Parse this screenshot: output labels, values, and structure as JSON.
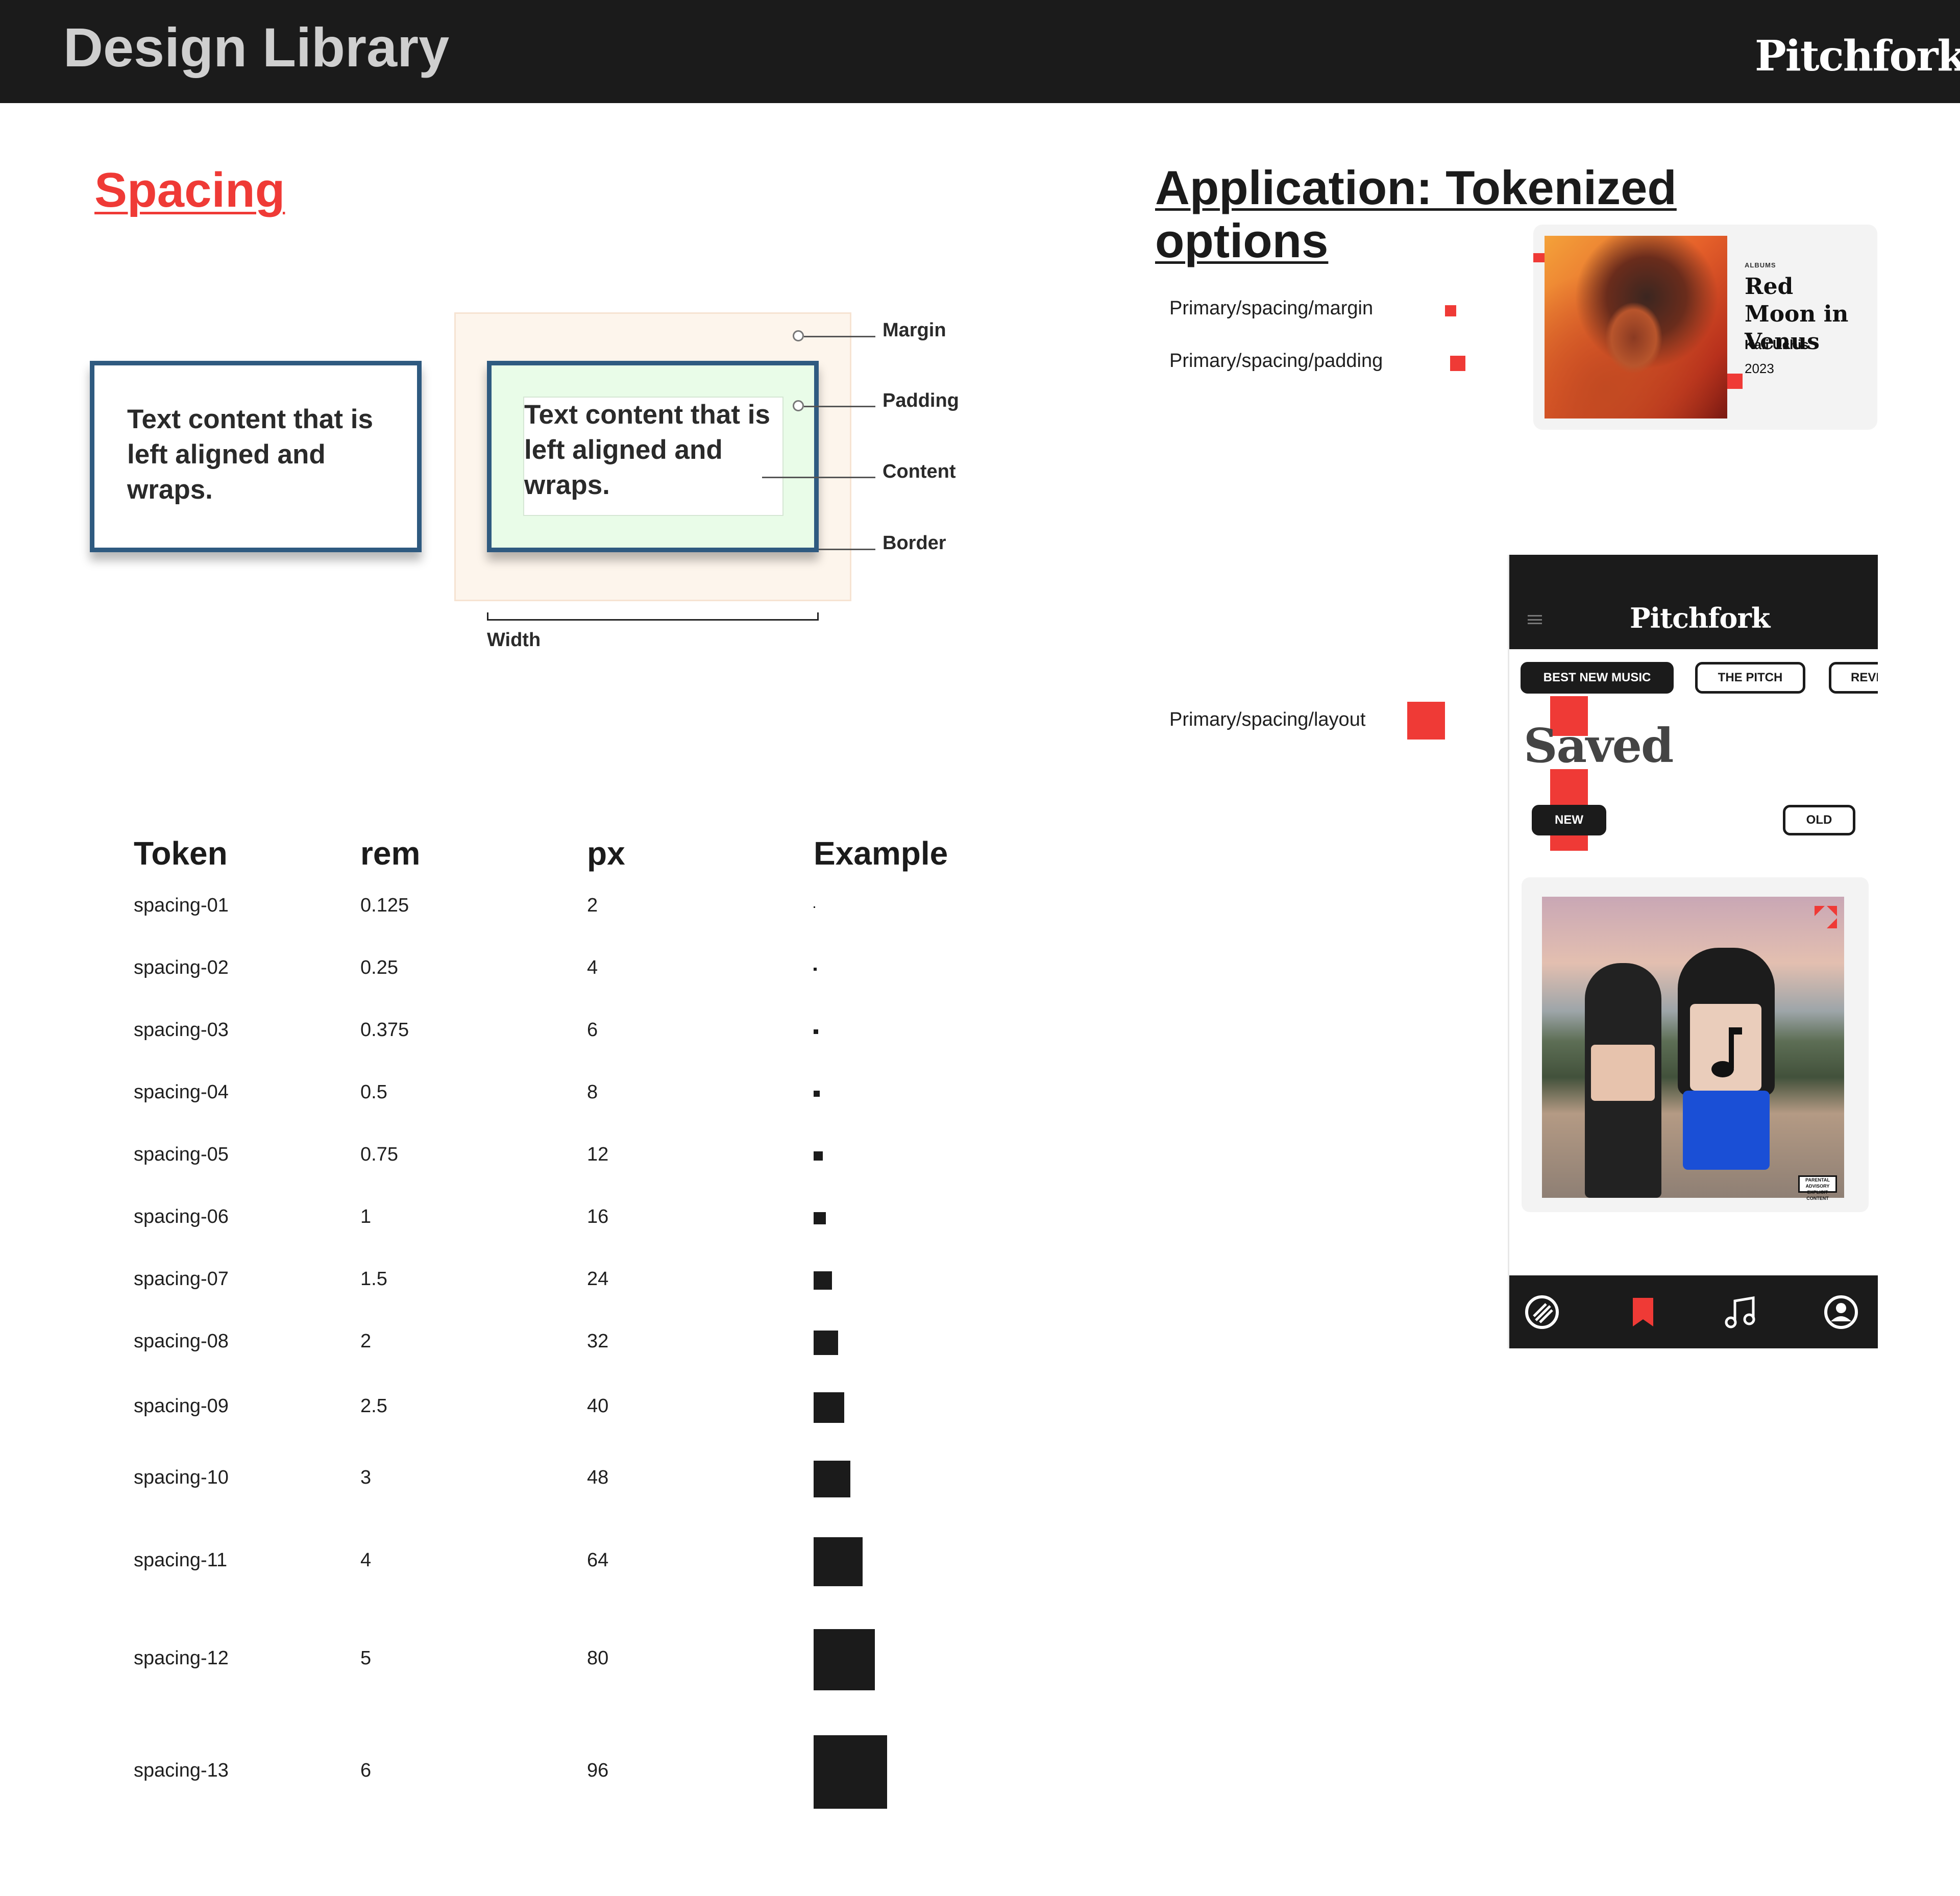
{
  "header": {
    "title": "Design Library",
    "brand": "Pitchfork"
  },
  "spacing": {
    "heading": "Spacing",
    "box_text": "Text content that is left aligned and wraps.",
    "labels": {
      "margin": "Margin",
      "padding": "Padding",
      "content": "Content",
      "border": "Border",
      "width": "Width"
    }
  },
  "table": {
    "headers": [
      "Token",
      "rem",
      "px",
      "Example"
    ],
    "rows": [
      {
        "token": "spacing-01",
        "rem": "0.125",
        "px": "2"
      },
      {
        "token": "spacing-02",
        "rem": "0.25",
        "px": "4"
      },
      {
        "token": "spacing-03",
        "rem": "0.375",
        "px": "6"
      },
      {
        "token": "spacing-04",
        "rem": "0.5",
        "px": "8"
      },
      {
        "token": "spacing-05",
        "rem": "0.75",
        "px": "12"
      },
      {
        "token": "spacing-06",
        "rem": "1",
        "px": "16"
      },
      {
        "token": "spacing-07",
        "rem": "1.5",
        "px": "24"
      },
      {
        "token": "spacing-08",
        "rem": "2",
        "px": "32"
      },
      {
        "token": "spacing-09",
        "rem": "2.5",
        "px": "40"
      },
      {
        "token": "spacing-10",
        "rem": "3",
        "px": "48"
      },
      {
        "token": "spacing-11",
        "rem": "4",
        "px": "64"
      },
      {
        "token": "spacing-12",
        "rem": "5",
        "px": "80"
      },
      {
        "token": "spacing-13",
        "rem": "6",
        "px": "96"
      }
    ]
  },
  "application": {
    "heading_line1": "Application: Tokenized",
    "heading_line2": "options",
    "options": {
      "margin": "Primary/spacing/margin",
      "padding": "Primary/spacing/padding",
      "layout": "Primary/spacing/layout"
    },
    "accent_color": "#ef3a36"
  },
  "album_card": {
    "kicker": "ALBUMS",
    "title": "Red Moon in Venus",
    "artist": "Kali Uchis",
    "year": "2023"
  },
  "phone": {
    "brand": "Pitchfork",
    "chips": [
      "BEST NEW MUSIC",
      "THE PITCH",
      "REVI"
    ],
    "page_title": "Saved",
    "filters": {
      "new": "NEW",
      "old": "OLD"
    },
    "advisory": "PARENTAL ADVISORY EXPLICIT CONTENT",
    "tab_icons": [
      "home-logo-icon",
      "bookmark-icon",
      "music-note-icon",
      "profile-icon"
    ]
  }
}
